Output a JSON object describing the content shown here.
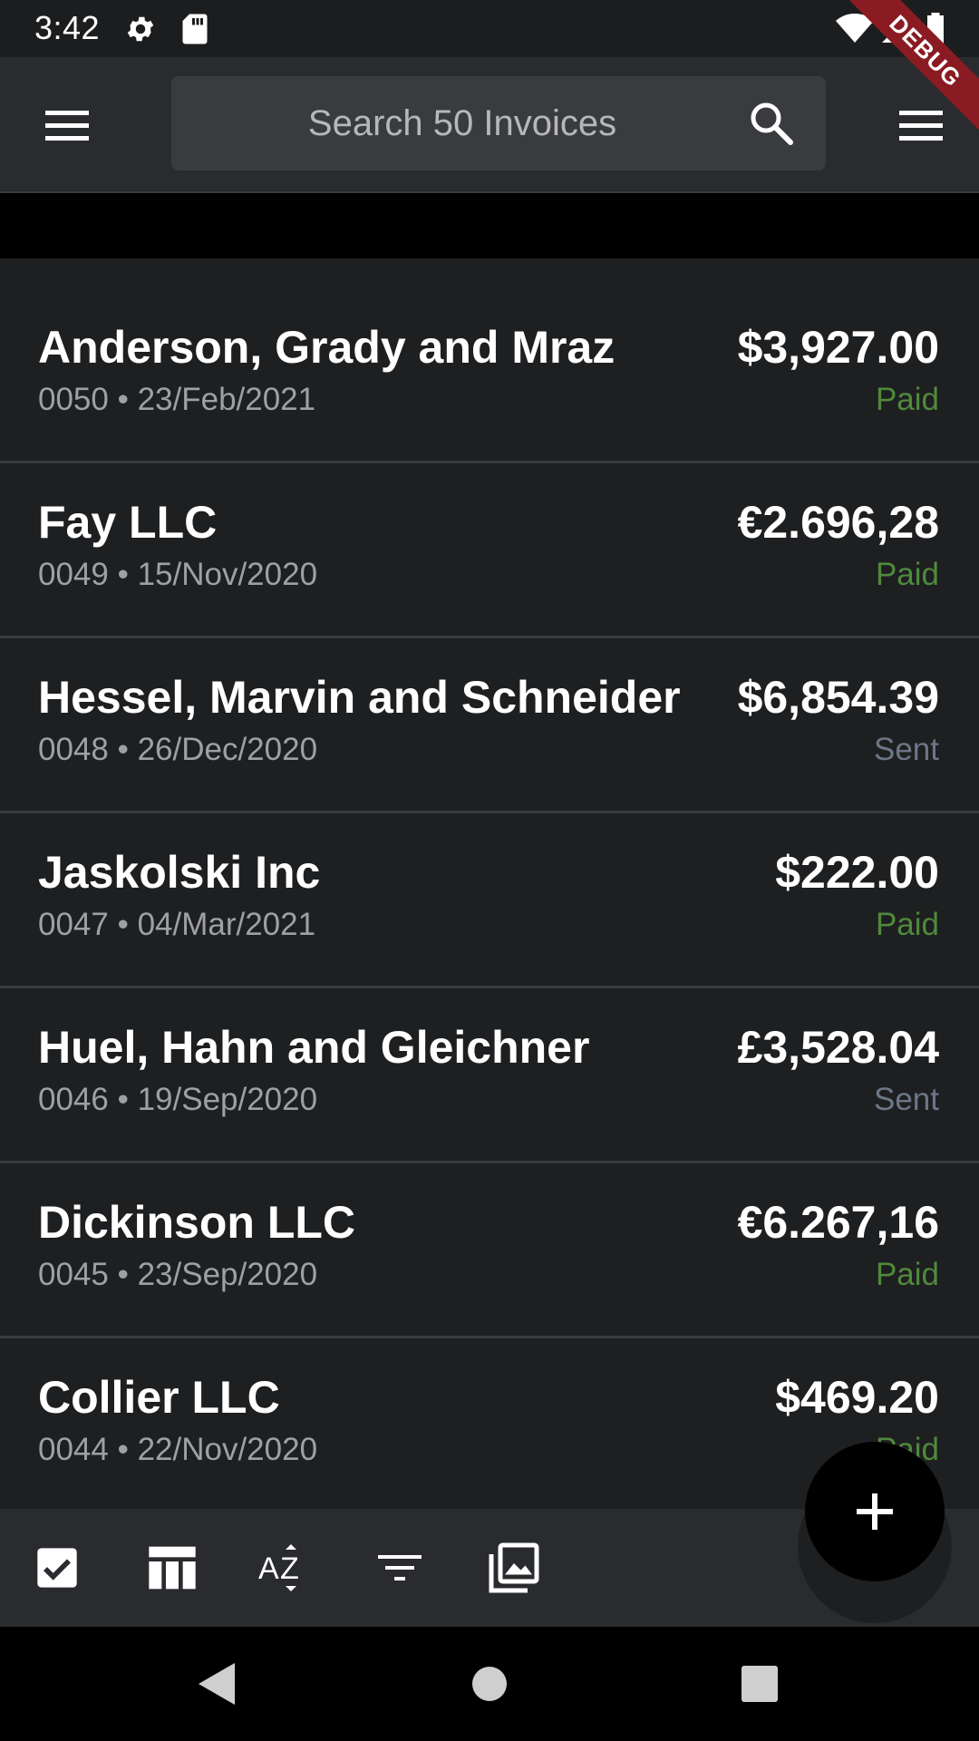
{
  "status_bar": {
    "time": "3:42",
    "icons": [
      "gear-icon",
      "sd-card-icon",
      "wifi-icon",
      "cell-signal-icon",
      "battery-icon"
    ]
  },
  "debug_banner": "DEBUG",
  "app_bar": {
    "left_menu_icon": "hamburger-menu-icon",
    "search_placeholder": "Search 50 Invoices",
    "search_icon": "search-icon",
    "right_menu_icon": "hamburger-menu-icon"
  },
  "invoices": [
    {
      "client": "Anderson, Grady and Mraz",
      "meta": "0050 • 23/Feb/2021",
      "amount": "$3,927.00",
      "status": "Paid"
    },
    {
      "client": "Fay LLC",
      "meta": "0049 • 15/Nov/2020",
      "amount": "€2.696,28",
      "status": "Paid"
    },
    {
      "client": "Hessel, Marvin and Schneider",
      "meta": "0048 • 26/Dec/2020",
      "amount": "$6,854.39",
      "status": "Sent"
    },
    {
      "client": "Jaskolski Inc",
      "meta": "0047 • 04/Mar/2021",
      "amount": "$222.00",
      "status": "Paid"
    },
    {
      "client": "Huel, Hahn and Gleichner",
      "meta": "0046 • 19/Sep/2020",
      "amount": "£3,528.04",
      "status": "Sent"
    },
    {
      "client": "Dickinson LLC",
      "meta": "0045 • 23/Sep/2020",
      "amount": "€6.267,16",
      "status": "Paid"
    },
    {
      "client": "Collier LLC",
      "meta": "0044 • 22/Nov/2020",
      "amount": "$469.20",
      "status": "Paid"
    }
  ],
  "colors": {
    "paid": "#4f8a3c",
    "sent": "#6c7787",
    "background": "#1e1f21",
    "app_bar": "#2a2b2e"
  },
  "bottom_toolbar": {
    "icons": [
      "checkbox-icon",
      "table-columns-icon",
      "sort-az-icon",
      "filter-icon",
      "gallery-icon"
    ]
  },
  "fab": {
    "icon": "plus-icon"
  },
  "nav_bar": {
    "icons": [
      "back-triangle-icon",
      "home-circle-icon",
      "recents-square-icon"
    ]
  }
}
